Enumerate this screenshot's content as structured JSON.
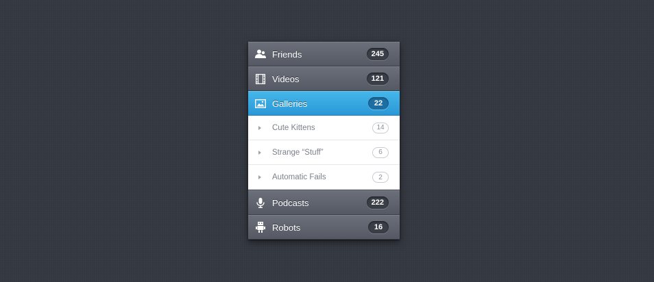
{
  "menu": {
    "friends": {
      "label": "Friends",
      "count": "245",
      "icon": "users-icon"
    },
    "videos": {
      "label": "Videos",
      "count": "121",
      "icon": "film-icon"
    },
    "galleries": {
      "label": "Galleries",
      "count": "22",
      "icon": "image-icon",
      "active": true,
      "children": [
        {
          "label": "Cute Kittens",
          "count": "14"
        },
        {
          "label": "Strange “Stuff”",
          "count": "6"
        },
        {
          "label": "Automatic Fails",
          "count": "2"
        }
      ]
    },
    "podcasts": {
      "label": "Podcasts",
      "count": "222",
      "icon": "microphone-icon"
    },
    "robots": {
      "label": "Robots",
      "count": "16",
      "icon": "robot-icon"
    }
  },
  "colors": {
    "accent": "#2fa6e0",
    "background": "#33373f",
    "item": "#5e636e"
  }
}
